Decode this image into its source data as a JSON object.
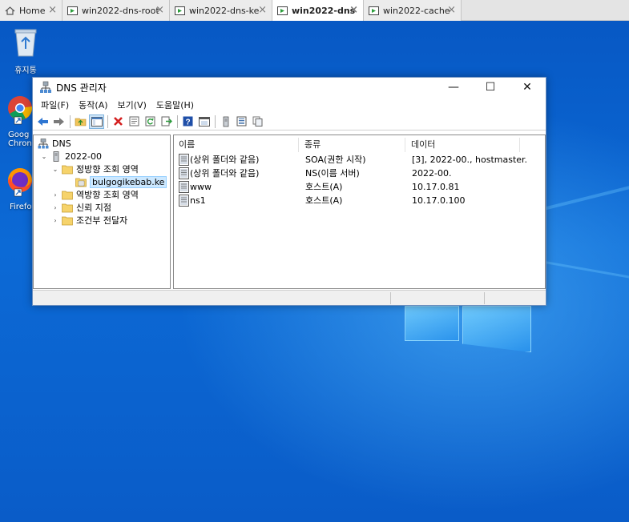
{
  "browser_tabs": [
    {
      "label": "Home",
      "icon": "home-icon",
      "active": false
    },
    {
      "label": "win2022-dns-root",
      "icon": "vm-icon",
      "active": false
    },
    {
      "label": "win2022-dns-ke",
      "icon": "vm-icon",
      "active": false
    },
    {
      "label": "win2022-dns",
      "icon": "vm-icon",
      "active": true
    },
    {
      "label": "win2022-cache",
      "icon": "vm-icon",
      "active": false
    }
  ],
  "desktop": {
    "recycle_bin_label": "휴지통",
    "chrome_label_line1": "Goog",
    "chrome_label_line2": "Chron",
    "firefox_label": "Firefo"
  },
  "window": {
    "title": "DNS 관리자",
    "minimize_glyph": "—",
    "maximize_glyph": "☐",
    "close_glyph": "✕"
  },
  "menu": [
    "파일(F)",
    "동작(A)",
    "보기(V)",
    "도움말(H)"
  ],
  "toolbar": [
    "back-icon",
    "forward-icon",
    "up-folder-icon",
    "show-tree-icon",
    "delete-icon",
    "properties-icon",
    "refresh-icon",
    "export-icon",
    "help-icon",
    "console-icon",
    "server-icon",
    "list-icon",
    "copy-icon"
  ],
  "tree": {
    "root": "DNS",
    "server": "2022-00",
    "forward_zones": "정방향 조회 영역",
    "zone": "bulgogikebab.ke",
    "reverse_zones": "역방향 조회 영역",
    "trust_points": "신뢰 지점",
    "conditional_forwarders": "조건부 전달자",
    "expanded_glyph": "⌄",
    "collapsed_glyph": "›"
  },
  "list": {
    "columns": [
      "이름",
      "종류",
      "데이터"
    ],
    "rows": [
      {
        "name": "(상위 폴더와 같음)",
        "type": "SOA(권한 시작)",
        "data": "[3], 2022-00., hostmaster."
      },
      {
        "name": "(상위 폴더와 같음)",
        "type": "NS(이름 서버)",
        "data": "2022-00."
      },
      {
        "name": "www",
        "type": "호스트(A)",
        "data": "10.17.0.81"
      },
      {
        "name": "ns1",
        "type": "호스트(A)",
        "data": "10.17.0.100"
      }
    ]
  },
  "colors": {
    "accent": "#0078d7",
    "desktop": "#0a63c9",
    "selection": "#cce8ff"
  }
}
